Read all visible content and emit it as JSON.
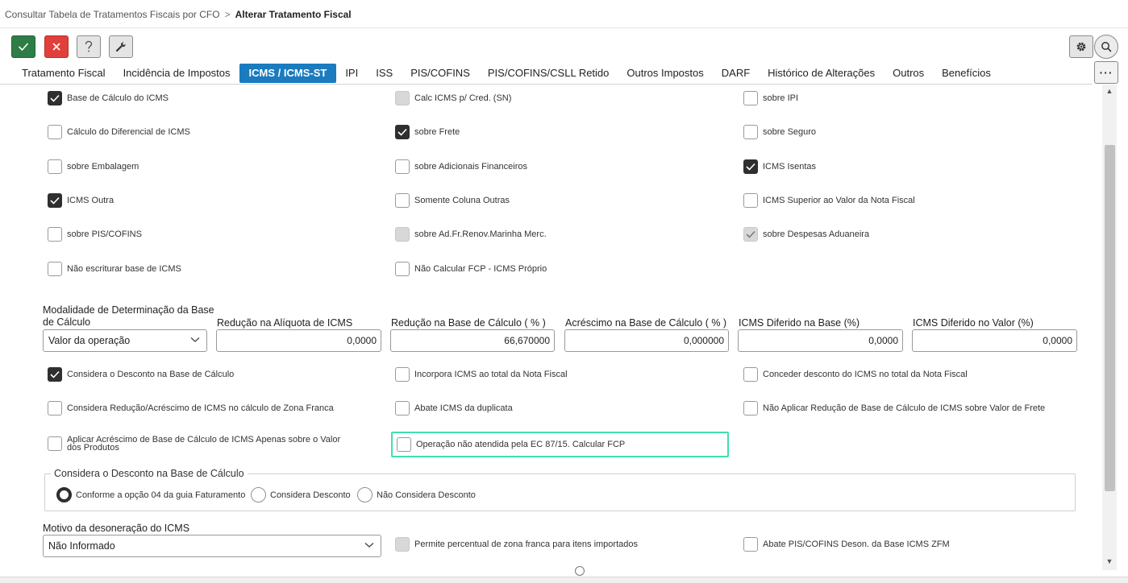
{
  "breadcrumb": {
    "parent": "Consultar Tabela de Tratamentos Fiscais por CFO",
    "separator": ">",
    "current": "Alterar Tratamento Fiscal"
  },
  "toolbar": {
    "confirm_icon": "check-icon",
    "cancel_icon": "x-icon",
    "help_icon": "question-icon",
    "tools_icon": "wrench-icon",
    "settings_icon": "gear-icon",
    "search_icon": "search-icon",
    "more_label": "···",
    "colors": {
      "confirm": "#2e7d46",
      "cancel": "#e0403b",
      "active_tab": "#1a7bbf",
      "focus": "#3ee0b0"
    }
  },
  "tabs": [
    {
      "label": "Tratamento Fiscal",
      "active": false
    },
    {
      "label": "Incidência de Impostos",
      "active": false
    },
    {
      "label": "ICMS / ICMS-ST",
      "active": true
    },
    {
      "label": "IPI",
      "active": false
    },
    {
      "label": "ISS",
      "active": false
    },
    {
      "label": "PIS/COFINS",
      "active": false
    },
    {
      "label": "PIS/COFINS/CSLL Retido",
      "active": false
    },
    {
      "label": "Outros Impostos",
      "active": false
    },
    {
      "label": "DARF",
      "active": false
    },
    {
      "label": "Histórico de Alterações",
      "active": false
    },
    {
      "label": "Outros",
      "active": false
    },
    {
      "label": "Benefícios",
      "active": false
    }
  ],
  "checks": {
    "base_calculo_icms": {
      "label": "Base de Cálculo do ICMS",
      "state": "checked"
    },
    "calc_icms_cred_sn": {
      "label": "Calc ICMS p/ Cred. (SN)",
      "state": "disabled"
    },
    "sobre_ipi": {
      "label": "sobre IPI",
      "state": "unchecked"
    },
    "calculo_diferencial": {
      "label": "Cálculo do Diferencial de ICMS",
      "state": "unchecked"
    },
    "sobre_frete": {
      "label": "sobre Frete",
      "state": "checked"
    },
    "sobre_seguro": {
      "label": "sobre Seguro",
      "state": "unchecked"
    },
    "sobre_embalagem": {
      "label": "sobre Embalagem",
      "state": "unchecked"
    },
    "sobre_adicionais": {
      "label": "sobre Adicionais Financeiros",
      "state": "unchecked"
    },
    "icms_isentas": {
      "label": "ICMS Isentas",
      "state": "checked"
    },
    "icms_outra": {
      "label": "ICMS Outra",
      "state": "checked"
    },
    "somente_coluna_outras": {
      "label": "Somente Coluna Outras",
      "state": "unchecked"
    },
    "icms_superior": {
      "label": "ICMS Superior ao Valor da Nota Fiscal",
      "state": "unchecked"
    },
    "sobre_pis_cofins": {
      "label": "sobre PIS/COFINS",
      "state": "unchecked"
    },
    "sobre_ad_fr_renov": {
      "label": "sobre Ad.Fr.Renov.Marinha Merc.",
      "state": "disabled"
    },
    "sobre_despesas_aduaneira": {
      "label": "sobre Despesas Aduaneira",
      "state": "disabled-checked"
    },
    "nao_escriturar": {
      "label": "Não escriturar base de ICMS",
      "state": "unchecked"
    },
    "nao_calcular_fcp": {
      "label": "Não Calcular FCP - ICMS Próprio",
      "state": "unchecked"
    },
    "considera_desconto": {
      "label": "Considera o Desconto na Base de Cálculo",
      "state": "checked"
    },
    "incorpora_icms": {
      "label": "Incorpora ICMS ao total da Nota Fiscal",
      "state": "unchecked"
    },
    "conceder_desconto": {
      "label": "Conceder desconto do ICMS no total da Nota Fiscal",
      "state": "unchecked"
    },
    "considera_reducao_zf": {
      "label": "Considera Redução/Acréscimo de ICMS no cálculo de Zona Franca",
      "state": "unchecked"
    },
    "abate_icms_duplicata": {
      "label": "Abate ICMS da duplicata",
      "state": "unchecked"
    },
    "nao_aplicar_reducao_frete": {
      "label": "Não Aplicar Redução de Base de Cálculo de ICMS sobre Valor de Frete",
      "state": "unchecked"
    },
    "aplicar_acrescimo": {
      "label": "Aplicar Acréscimo de Base de Cálculo de ICMS Apenas sobre o Valor dos Produtos",
      "state": "unchecked"
    },
    "operacao_nao_atendida": {
      "label": "Operação não atendida pela EC 87/15. Calcular FCP",
      "state": "unchecked"
    },
    "permite_percentual_zf": {
      "label": "Permite percentual de zona franca para itens importados",
      "state": "disabled"
    },
    "abate_pis_cofins_zfm": {
      "label": "Abate PIS/COFINS Deson. da Base ICMS ZFM",
      "state": "unchecked"
    }
  },
  "fields": {
    "modalidade": {
      "label": "Modalidade de Determinação da Base de Cálculo",
      "value": "Valor da operação"
    },
    "reducao_aliquota": {
      "label": "Redução na Alíquota de ICMS",
      "value": "0,0000"
    },
    "reducao_base": {
      "label": "Redução na Base de Cálculo ( % )",
      "value": "66,670000"
    },
    "acrescimo_base": {
      "label": "Acréscimo na Base de Cálculo ( % )",
      "value": "0,000000"
    },
    "diferido_base": {
      "label": "ICMS Diferido na Base (%)",
      "value": "0,0000"
    },
    "diferido_valor": {
      "label": "ICMS Diferido no Valor (%)",
      "value": "0,0000"
    },
    "motivo_desoneracao": {
      "label": "Motivo da desoneração do ICMS",
      "value": "Não Informado"
    }
  },
  "desconto_group": {
    "legend": "Considera o Desconto na Base de Cálculo",
    "options": [
      {
        "label": "Conforme a opção 04 da guia Faturamento",
        "selected": true
      },
      {
        "label": "Considera Desconto",
        "selected": false
      },
      {
        "label": "Não Considera Desconto",
        "selected": false
      }
    ]
  }
}
